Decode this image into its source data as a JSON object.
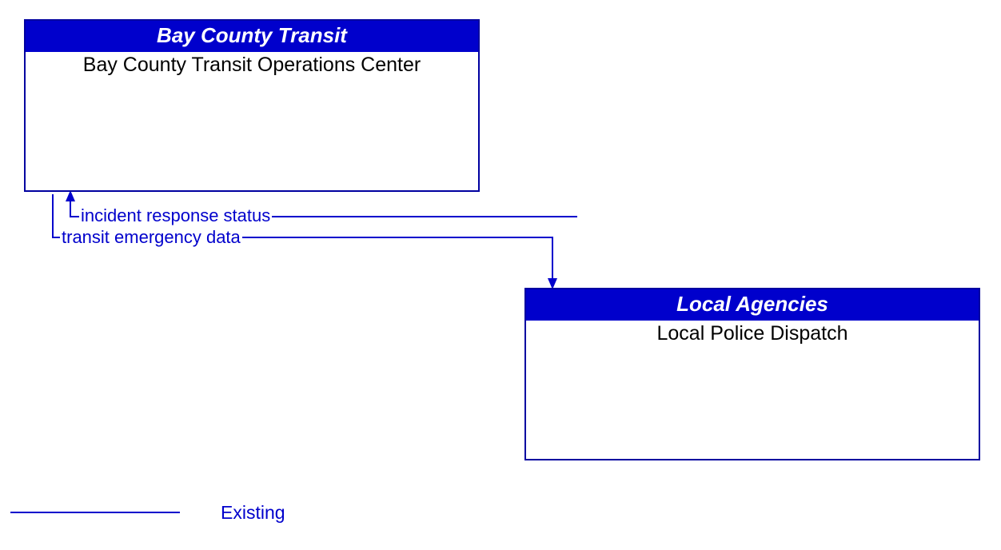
{
  "entities": {
    "top": {
      "header": "Bay County Transit",
      "body": "Bay County Transit Operations Center"
    },
    "bottom": {
      "header": "Local Agencies",
      "body": "Local Police Dispatch"
    }
  },
  "flows": {
    "incident_response_status": "incident response status",
    "transit_emergency_data": "transit emergency data"
  },
  "legend": {
    "existing": "Existing"
  },
  "colors": {
    "line": "#0000cc"
  }
}
